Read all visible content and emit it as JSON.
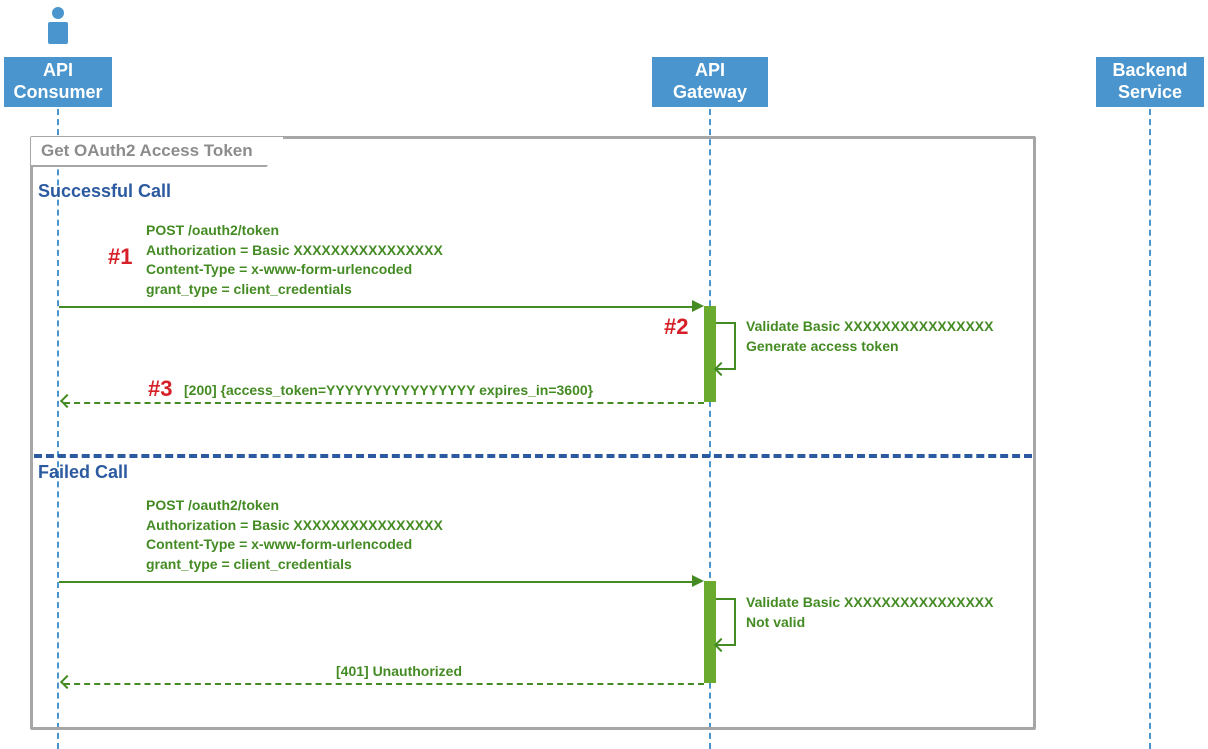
{
  "participants": {
    "consumer": "API Consumer",
    "gateway": "API Gateway",
    "backend": "Backend Service"
  },
  "frame_title": "Get OAuth2 Access Token",
  "sections": {
    "success": "Successful Call",
    "failed": "Failed Call"
  },
  "markers": {
    "m1": "#1",
    "m2": "#2",
    "m3": "#3"
  },
  "success_call": {
    "req_line1": "POST /oauth2/token",
    "req_line2": "Authorization = Basic XXXXXXXXXXXXXXXX",
    "req_line3": "Content-Type = x-www-form-urlencoded",
    "req_line4": "grant_type = client_credentials",
    "proc_line1": "Validate Basic XXXXXXXXXXXXXXXX",
    "proc_line2": "Generate access token",
    "resp": "[200] {access_token=YYYYYYYYYYYYYYYY expires_in=3600}"
  },
  "failed_call": {
    "req_line1": "POST /oauth2/token",
    "req_line2": "Authorization = Basic XXXXXXXXXXXXXXXX",
    "req_line3": "Content-Type = x-www-form-urlencoded",
    "req_line4": "grant_type = client_credentials",
    "proc_line1": "Validate Basic XXXXXXXXXXXXXXXX",
    "proc_line2": "Not valid",
    "resp": "[401] Unauthorized"
  }
}
